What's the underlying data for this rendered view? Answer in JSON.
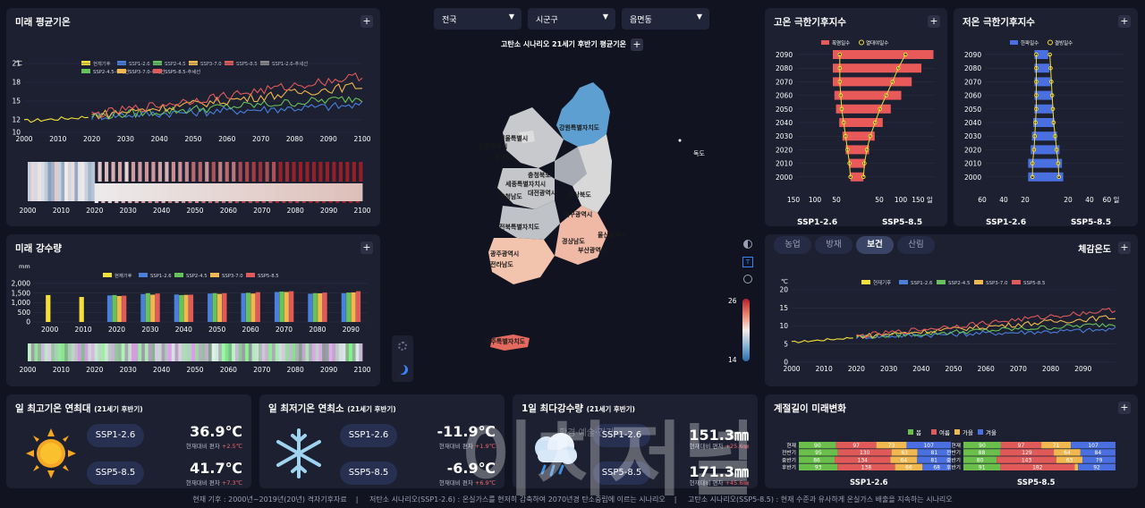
{
  "colors": {
    "now": "#f5e03a",
    "s126": "#4a7fdc",
    "s245": "#66c25a",
    "s370": "#f0b84e",
    "s585": "#e05a5a",
    "accent": "#3b82f6"
  },
  "panels": {
    "temp": {
      "title": "미래 평균기온",
      "unit": "℃"
    },
    "precip": {
      "title": "미래 강수량",
      "unit": "mm"
    },
    "hot": {
      "title": "고온 극한기후지수",
      "legend": [
        "폭염일수",
        "열대야일수"
      ]
    },
    "cold": {
      "title": "저온 극한기후지수",
      "legend": [
        "한파일수",
        "결빙일수"
      ]
    },
    "felt": {
      "tabs": [
        "농업",
        "방재",
        "보건",
        "산림"
      ],
      "active": "보건",
      "title": "체감온도",
      "unit": "℃"
    },
    "season": {
      "title": "계절길이 미래변화",
      "legend": [
        "봄",
        "여름",
        "가을",
        "겨울"
      ]
    }
  },
  "legend_main": [
    "현재기후",
    "SSP1-2.6",
    "SSP2-4.5",
    "SSP3-7.0",
    "SSP5-8.5"
  ],
  "legend_trend": [
    "SSP1-2.6-추세선",
    "SSP2-4.5-추세선",
    "SSP3-7.0-추세선",
    "SSP5-8.5-추세선"
  ],
  "filters": {
    "a": "전국",
    "b": "시군구",
    "c": "읍면동"
  },
  "map": {
    "title": "고탄소 시나리오 21세기 후반기 평균기온",
    "scale_max": "26",
    "scale_min": "14",
    "regions": [
      "강원특별자치도",
      "서울특별시",
      "인천광역시",
      "경기도",
      "충청북도",
      "세종특별자치시",
      "대전광역시",
      "충청남도",
      "경상북도",
      "대구광역시",
      "전북특별자치도",
      "울산광역시",
      "경상남도",
      "부산광역시",
      "광주광역시",
      "전라남도",
      "제주특별자치도",
      "독도"
    ]
  },
  "ssp": {
    "low": "SSP1-2.6",
    "high": "SSP5-8.5"
  },
  "hot_axis": [
    "150",
    "100",
    "50",
    "",
    "50",
    "100",
    "150 일"
  ],
  "cold_axis": [
    "60",
    "40",
    "20",
    "",
    "20",
    "40",
    "60 일"
  ],
  "year_axis": [
    "2090",
    "2080",
    "2070",
    "2060",
    "2050",
    "2040",
    "2030",
    "2020",
    "2010",
    "2000"
  ],
  "cards": {
    "hi": {
      "title": "일 최고기온 연최대",
      "sub": "(21세기 후반기)",
      "v1": "36.9℃",
      "d1": "현재대비 편차 ",
      "d1v": "+2.5℃",
      "v2": "41.7℃",
      "d2": "현재대비 편차 ",
      "d2v": "+7.3℃"
    },
    "lo": {
      "title": "일 최저기온 연최소",
      "sub": "(21세기 후반기)",
      "v1": "-11.9℃",
      "d1": "현재대비 편차 ",
      "d1v": "+1.9℃",
      "v2": "-6.9℃",
      "d2": "현재대비 편차 ",
      "d2v": "+6.9℃"
    },
    "rain": {
      "title": "1일 최다강수량",
      "sub": "(21세기 후반기)",
      "v1": "151.3㎜",
      "d1": "현재대비 편차 ",
      "d1v": "+25.6㎜",
      "v2": "171.3㎜",
      "d2": "현재대비 편차 ",
      "d2v": "+45.6㎜"
    }
  },
  "season_rows": {
    "labels": [
      "현재",
      "전반기",
      "중반기",
      "후반기"
    ],
    "low": [
      [
        "90",
        "97",
        "73",
        "107"
      ],
      [
        "95",
        "130",
        "63",
        "81"
      ],
      [
        "86",
        "134",
        "64",
        "81"
      ],
      [
        "93",
        "138",
        "66",
        "68"
      ]
    ],
    "high": [
      [
        "90",
        "97",
        "71",
        "107"
      ],
      [
        "88",
        "129",
        "64",
        "84"
      ],
      [
        "80",
        "143",
        "63",
        "79"
      ],
      [
        "91",
        "182",
        "",
        "92"
      ]
    ]
  },
  "footer": [
    "현재 기후 : 2000년~2019년(20년) 격자기후자료",
    "저탄소 시나리오(SSP1-2.6) : 온실가스를 현저히 감축하여 2070년경 탄소중립에 이르는 시나리오",
    "고탄소 시나리오(SSP5-8.5) : 현재 수준과 유사하게 온실가스 배출을 지속하는 시나리오"
  ],
  "watermark": "이치저널",
  "watermark_sub": "환경·예술·건강",
  "chart_data": [
    {
      "type": "line",
      "title": "미래 평균기온",
      "ylabel": "℃",
      "ylim": [
        10,
        21
      ],
      "yticks": [
        10,
        12,
        15,
        18,
        21
      ],
      "xlim": [
        2000,
        2100
      ],
      "series": [
        {
          "name": "현재기후",
          "x_range": [
            2000,
            2019
          ],
          "start": 11.8,
          "end": 12.5
        },
        {
          "name": "SSP1-2.6",
          "x_range": [
            2020,
            2100
          ],
          "start": 12.6,
          "end": 14.3
        },
        {
          "name": "SSP2-4.5",
          "x_range": [
            2020,
            2100
          ],
          "start": 12.6,
          "end": 15.5
        },
        {
          "name": "SSP3-7.0",
          "x_range": [
            2020,
            2100
          ],
          "start": 12.7,
          "end": 17.5
        },
        {
          "name": "SSP5-8.5",
          "x_range": [
            2020,
            2100
          ],
          "start": 12.8,
          "end": 19.0
        }
      ]
    },
    {
      "type": "bar",
      "title": "미래 강수량",
      "ylabel": "mm",
      "ylim": [
        0,
        2000
      ],
      "yticks": [
        0,
        500,
        1000,
        1500,
        2000
      ],
      "categories": [
        "2000",
        "2010",
        "2020",
        "2030",
        "2040",
        "2050",
        "2060",
        "2070",
        "2080",
        "2090"
      ],
      "series": [
        {
          "name": "현재기후",
          "values": [
            1400,
            1300,
            null,
            null,
            null,
            null,
            null,
            null,
            null,
            null
          ]
        },
        {
          "name": "SSP1-2.6",
          "values": [
            null,
            null,
            1380,
            1450,
            1430,
            1480,
            1500,
            1560,
            1470,
            1500
          ]
        },
        {
          "name": "SSP2-4.5",
          "values": [
            null,
            null,
            1400,
            1500,
            1400,
            1500,
            1520,
            1580,
            1500,
            1530
          ]
        },
        {
          "name": "SSP3-7.0",
          "values": [
            null,
            null,
            1350,
            1420,
            1410,
            1460,
            1480,
            1560,
            1490,
            1540
          ]
        },
        {
          "name": "SSP5-8.5",
          "values": [
            null,
            null,
            1370,
            1480,
            1420,
            1500,
            1550,
            1600,
            1530,
            1600
          ]
        }
      ]
    },
    {
      "type": "line",
      "title": "체감온도",
      "ylabel": "℃",
      "ylim": [
        0,
        20
      ],
      "yticks": [
        0,
        5,
        10,
        15,
        20
      ],
      "xlim": [
        2000,
        2100
      ],
      "series": [
        {
          "name": "현재기후",
          "x_range": [
            2000,
            2019
          ],
          "start": 5.5,
          "end": 6.8
        },
        {
          "name": "SSP1-2.6",
          "x_range": [
            2020,
            2100
          ],
          "start": 7.0,
          "end": 9.0
        },
        {
          "name": "SSP2-4.5",
          "x_range": [
            2020,
            2100
          ],
          "start": 7.0,
          "end": 10.5
        },
        {
          "name": "SSP3-7.0",
          "x_range": [
            2020,
            2100
          ],
          "start": 7.1,
          "end": 12.5
        },
        {
          "name": "SSP5-8.5",
          "x_range": [
            2020,
            2100
          ],
          "start": 7.2,
          "end": 14.5
        }
      ]
    },
    {
      "type": "bar",
      "title": "고온 극한기후지수",
      "categories": [
        "2000",
        "2010",
        "2020",
        "2030",
        "2040",
        "2050",
        "2060",
        "2070",
        "2080",
        "2090"
      ],
      "series": [
        {
          "name": "폭염일수 SSP1-2.6",
          "values": [
            8,
            10,
            14,
            18,
            22,
            26,
            28,
            30,
            30,
            30
          ]
        },
        {
          "name": "폭염일수 SSP5-8.5",
          "values": [
            8,
            10,
            15,
            22,
            32,
            42,
            55,
            68,
            80,
            95
          ]
        }
      ]
    },
    {
      "type": "bar",
      "title": "저온 극한기후지수",
      "categories": [
        "2000",
        "2010",
        "2020",
        "2030",
        "2040",
        "2050",
        "2060",
        "2070",
        "2080",
        "2090"
      ],
      "series": [
        {
          "name": "한파일수 SSP1-2.6",
          "values": [
            14,
            14,
            12,
            11,
            10,
            9,
            9,
            9,
            9,
            9
          ]
        },
        {
          "name": "한파일수 SSP5-8.5",
          "values": [
            14,
            13,
            11,
            9,
            7,
            6,
            5,
            4,
            3,
            2
          ]
        }
      ]
    }
  ]
}
